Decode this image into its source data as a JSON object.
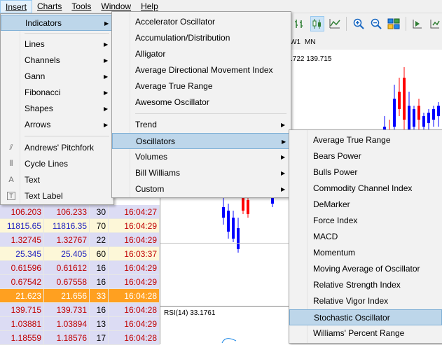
{
  "menubar": {
    "items": [
      "Insert",
      "Charts",
      "Tools",
      "Window",
      "Help"
    ]
  },
  "toolbar": {
    "icons": [
      "bar-chart-icon",
      "candlestick-icon",
      "line-chart-icon",
      "zoom-in-icon",
      "zoom-out-icon",
      "tile-windows-icon",
      "auto-scroll-icon",
      "chart-shift-icon"
    ]
  },
  "timeframes": [
    "W1",
    "MN"
  ],
  "chart": {
    "price_header": ".722 139.715",
    "rsi_label": "RSI(14) 33.1761"
  },
  "market_watch": {
    "rows": [
      {
        "bid": "106.203",
        "ask": "106.233",
        "spread": "30",
        "time": "16:04:27",
        "bg": "#dcdcf4"
      },
      {
        "bid": "11815.65",
        "ask": "11816.35",
        "spread": "70",
        "time": "16:04:29",
        "bg": "#fdf7d8"
      },
      {
        "bid": "1.32745",
        "ask": "1.32767",
        "spread": "22",
        "time": "16:04:29",
        "bg": "#dcdcf4"
      },
      {
        "bid": "25.345",
        "ask": "25.405",
        "spread": "60",
        "time": "16:03:37",
        "bg": "#fdf7d8"
      },
      {
        "bid": "0.61596",
        "ask": "0.61612",
        "spread": "16",
        "time": "16:04:29",
        "bg": "#dcdcf4"
      },
      {
        "bid": "0.67542",
        "ask": "0.67558",
        "spread": "16",
        "time": "16:04:29",
        "bg": "#dcdcf4"
      },
      {
        "bid": "21.623",
        "ask": "21.656",
        "spread": "33",
        "time": "16:04:28",
        "bg": "#ffa020"
      },
      {
        "bid": "139.715",
        "ask": "139.731",
        "spread": "16",
        "time": "16:04:28",
        "bg": "#dcdcf4"
      },
      {
        "bid": "1.03881",
        "ask": "1.03894",
        "spread": "13",
        "time": "16:04:29",
        "bg": "#dcdcf4"
      },
      {
        "bid": "1.18559",
        "ask": "1.18576",
        "spread": "17",
        "time": "16:04:28",
        "bg": "#dcdcf4"
      }
    ]
  },
  "insert_menu": {
    "items": [
      {
        "label": "Indicators",
        "submenu": true
      },
      {
        "label": "Lines",
        "submenu": true
      },
      {
        "label": "Channels",
        "submenu": true
      },
      {
        "label": "Gann",
        "submenu": true
      },
      {
        "label": "Fibonacci",
        "submenu": true
      },
      {
        "label": "Shapes",
        "submenu": true
      },
      {
        "label": "Arrows",
        "submenu": true
      },
      {
        "label": "Andrews' Pitchfork",
        "icon": "pitchfork-icon"
      },
      {
        "label": "Cycle Lines",
        "icon": "cycle-lines-icon"
      },
      {
        "label": "Text",
        "icon": "text-icon"
      },
      {
        "label": "Text Label",
        "icon": "text-label-icon"
      }
    ]
  },
  "indicators_menu": {
    "items": [
      {
        "label": "Accelerator Oscillator"
      },
      {
        "label": "Accumulation/Distribution"
      },
      {
        "label": "Alligator"
      },
      {
        "label": "Average Directional Movement Index"
      },
      {
        "label": "Average True Range"
      },
      {
        "label": "Awesome Oscillator"
      },
      {
        "label": "Trend",
        "submenu": true
      },
      {
        "label": "Oscillators",
        "submenu": true
      },
      {
        "label": "Volumes",
        "submenu": true
      },
      {
        "label": "Bill Williams",
        "submenu": true
      },
      {
        "label": "Custom",
        "submenu": true
      }
    ]
  },
  "oscillators_menu": {
    "items": [
      {
        "label": "Average True Range"
      },
      {
        "label": "Bears Power"
      },
      {
        "label": "Bulls Power"
      },
      {
        "label": "Commodity Channel Index"
      },
      {
        "label": "DeMarker"
      },
      {
        "label": "Force Index"
      },
      {
        "label": "MACD"
      },
      {
        "label": "Momentum"
      },
      {
        "label": "Moving Average of Oscillator"
      },
      {
        "label": "Relative Strength Index"
      },
      {
        "label": "Relative Vigor Index"
      },
      {
        "label": "Stochastic Oscillator"
      },
      {
        "label": "Williams' Percent Range"
      }
    ]
  },
  "colors": {
    "bull": "#0000ff",
    "bear": "#ff0000",
    "highlight": "#bdd6ea",
    "orange_row": "#ffa020"
  }
}
